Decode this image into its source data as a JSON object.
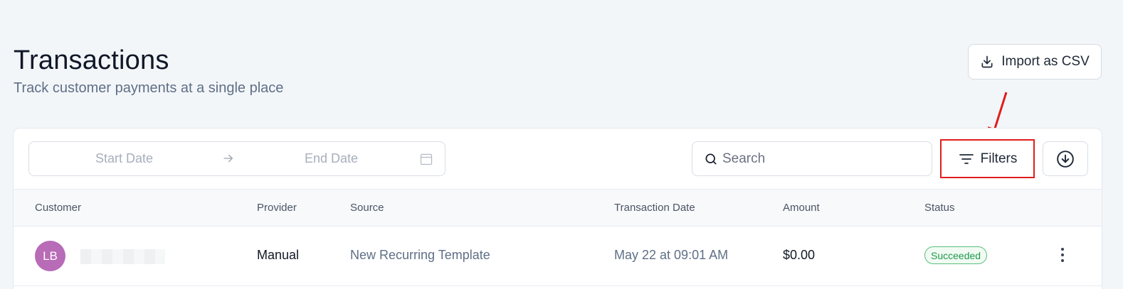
{
  "header": {
    "title": "Transactions",
    "subtitle": "Track customer payments at a single place",
    "import_label": "Import as CSV",
    "import_icon": "download-tray-icon"
  },
  "toolbar": {
    "start_date_placeholder": "Start Date",
    "end_date_placeholder": "End Date",
    "search_placeholder": "Search",
    "filters_label": "Filters",
    "highlight_color": "#e11d1d"
  },
  "table": {
    "columns": [
      "Customer",
      "Provider",
      "Source",
      "Transaction Date",
      "Amount",
      "Status"
    ],
    "rows": [
      {
        "avatar_initials": "LB",
        "avatar_color": "#b86bb6",
        "provider": "Manual",
        "source": "New Recurring Template",
        "transaction_date": "May 22 at 09:01 AM",
        "amount": "$0.00",
        "status": "Succeeded",
        "status_color": "#1f9a4a"
      }
    ]
  }
}
